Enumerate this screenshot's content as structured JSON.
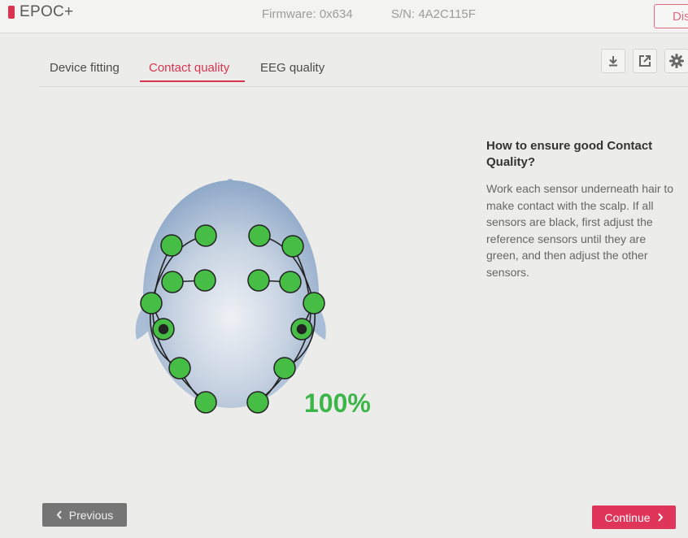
{
  "app": {
    "name": "EPOC+",
    "brand_color": "#d9344f"
  },
  "header": {
    "firmware": "Firmware: 0x634",
    "serial": "S/N: 4A2C115F",
    "disconnect_label": "Dis"
  },
  "tabs": [
    {
      "label": "Device fitting",
      "active": false
    },
    {
      "label": "Contact quality",
      "active": true
    },
    {
      "label": "EEG quality",
      "active": false
    }
  ],
  "toolbar": {
    "icons": [
      "download-icon",
      "export-icon",
      "gear-icon"
    ]
  },
  "help": {
    "title": "How to ensure good Contact Quality?",
    "body": "Work each sensor underneath hair to make contact with the scalp. If all sensors are black, first adjust the reference sensors until they are green, and then adjust the other sensors."
  },
  "contact_quality": {
    "percent_label": "100%",
    "sensor_color": "#46be46",
    "reference_color": "#222222",
    "sensor_count": 16
  },
  "footer": {
    "previous_label": "Previous",
    "continue_label": "Continue"
  }
}
